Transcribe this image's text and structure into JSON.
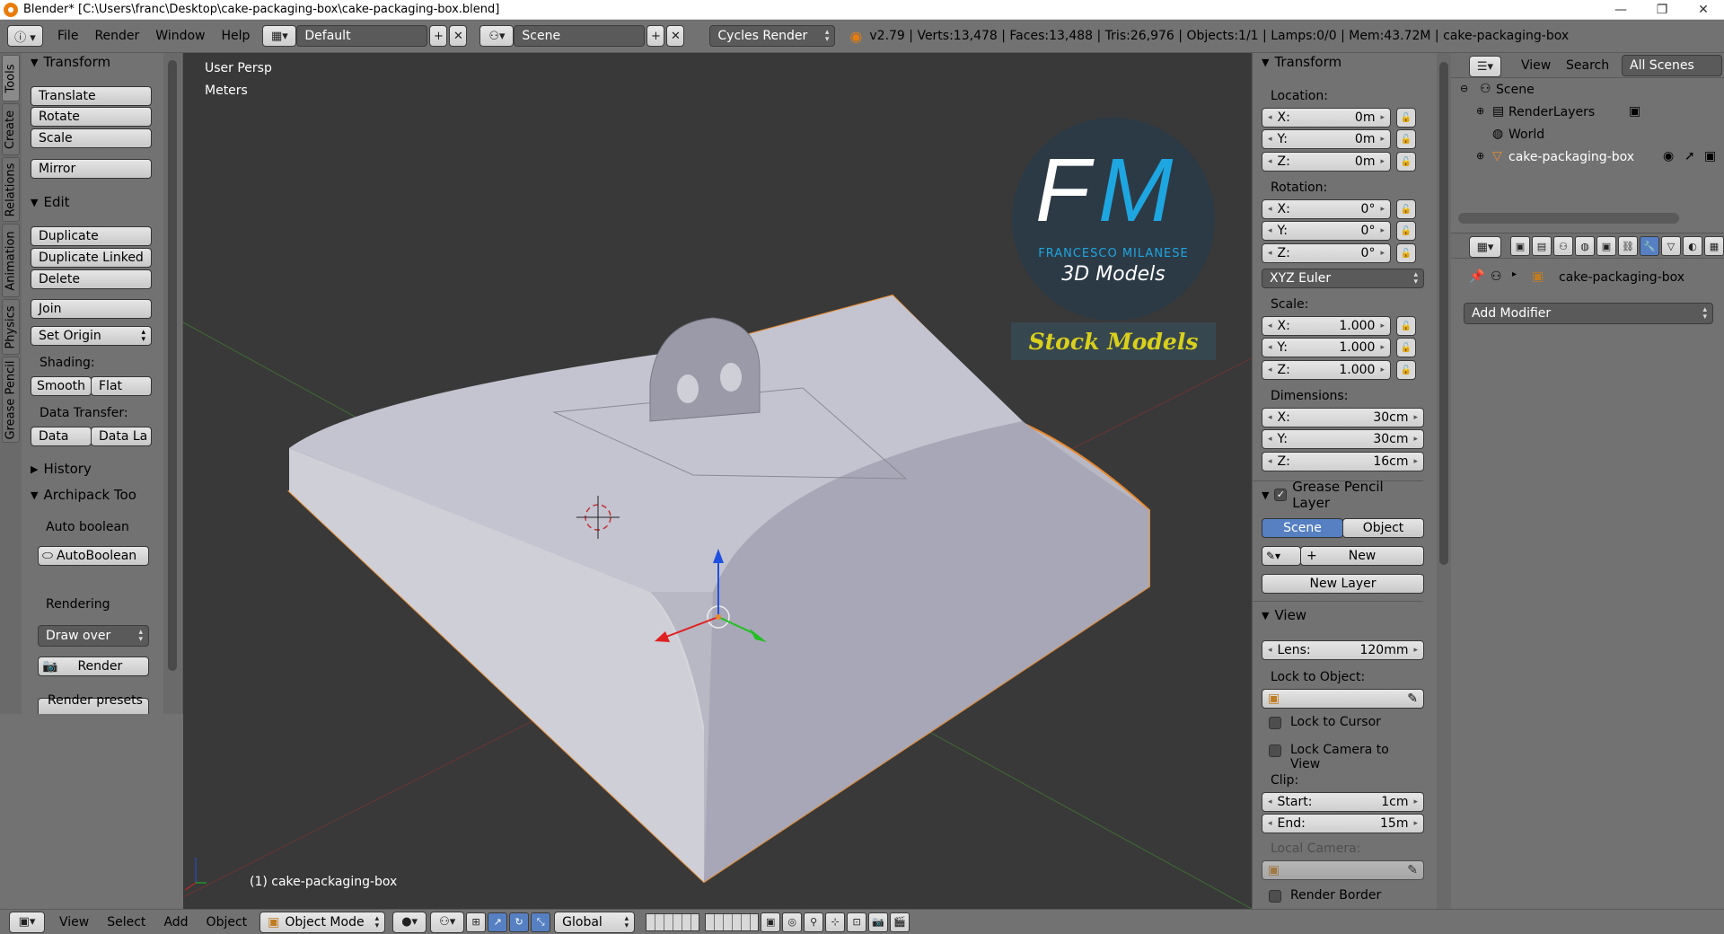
{
  "window": {
    "title": "Blender* [C:\\Users\\franc\\Desktop\\cake-packaging-box\\cake-packaging-box.blend]",
    "minimize": "—",
    "maximize": "❐",
    "close": "✕"
  },
  "topbar": {
    "menus": [
      "File",
      "Render",
      "Window",
      "Help"
    ],
    "layout": "Default",
    "scene": "Scene",
    "engine": "Cycles Render",
    "stats": "v2.79 | Verts:13,478 | Faces:13,488 | Tris:26,976 | Objects:1/1 | Lamps:0/0 | Mem:43.72M | cake-packaging-box"
  },
  "lefttabs": [
    "Tools",
    "Create",
    "Relations",
    "Animation",
    "Physics",
    "Grease Pencil"
  ],
  "tools": {
    "transform": {
      "header": "Transform",
      "translate": "Translate",
      "rotate": "Rotate",
      "scale": "Scale",
      "mirror": "Mirror"
    },
    "edit": {
      "header": "Edit",
      "duplicate": "Duplicate",
      "duplicate_linked": "Duplicate Linked",
      "delete": "Delete",
      "join": "Join",
      "set_origin": "Set Origin",
      "shading_label": "Shading:",
      "smooth": "Smooth",
      "flat": "Flat",
      "data_transfer_label": "Data Transfer:",
      "data": "Data",
      "data_la": "Data La"
    },
    "history": {
      "header": "History"
    },
    "archipack": {
      "header": "Archipack Too",
      "auto_boolean_label": "Auto boolean",
      "autoboolean_btn": "AutoBoolean",
      "rendering_label": "Rendering",
      "draw_over": "Draw over",
      "render_btn": "Render",
      "render_presets": "Render presets ..."
    }
  },
  "viewport": {
    "view_name": "User Persp",
    "units": "Meters",
    "object_label": "(1) cake-packaging-box",
    "watermark": {
      "initials_f": "F",
      "initials_m": "M",
      "name": "FRANCESCO MILANESE",
      "subtitle": "3D Models",
      "banner": "Stock Models"
    }
  },
  "nprops": {
    "transform_header": "Transform",
    "location_label": "Location:",
    "location": [
      {
        "axis": "X:",
        "value": "0m"
      },
      {
        "axis": "Y:",
        "value": "0m"
      },
      {
        "axis": "Z:",
        "value": "0m"
      }
    ],
    "rotation_label": "Rotation:",
    "rotation": [
      {
        "axis": "X:",
        "value": "0°"
      },
      {
        "axis": "Y:",
        "value": "0°"
      },
      {
        "axis": "Z:",
        "value": "0°"
      }
    ],
    "rotation_mode": "XYZ Euler",
    "scale_label": "Scale:",
    "scale": [
      {
        "axis": "X:",
        "value": "1.000"
      },
      {
        "axis": "Y:",
        "value": "1.000"
      },
      {
        "axis": "Z:",
        "value": "1.000"
      }
    ],
    "dimensions_label": "Dimensions:",
    "dimensions": [
      {
        "axis": "X:",
        "value": "30cm"
      },
      {
        "axis": "Y:",
        "value": "30cm"
      },
      {
        "axis": "Z:",
        "value": "16cm"
      }
    ],
    "grease_header": "Grease Pencil Layer",
    "gp_scene": "Scene",
    "gp_object": "Object",
    "gp_new": "New",
    "gp_new_layer": "New Layer",
    "view_header": "View",
    "lens_label": "Lens:",
    "lens_value": "120mm",
    "lock_to_object_label": "Lock to Object:",
    "lock_to_cursor": "Lock to Cursor",
    "lock_camera": "Lock Camera to View",
    "clip_label": "Clip:",
    "clip_start_label": "Start:",
    "clip_start": "1cm",
    "clip_end_label": "End:",
    "clip_end": "15m",
    "local_camera_label": "Local Camera:",
    "render_border": "Render Border"
  },
  "outliner": {
    "view": "View",
    "search": "Search",
    "all_scenes": "All Scenes",
    "items": [
      {
        "label": "Scene"
      },
      {
        "label": "RenderLayers"
      },
      {
        "label": "World"
      },
      {
        "label": "cake-packaging-box"
      }
    ]
  },
  "properties": {
    "object_name": "cake-packaging-box",
    "add_modifier": "Add Modifier"
  },
  "bottombar": {
    "menus": [
      "View",
      "Select",
      "Add",
      "Object"
    ],
    "mode": "Object Mode",
    "orientation": "Global"
  },
  "colors": {
    "accent": "#5680c2",
    "viewport_bg": "#393939",
    "panel_bg": "#727272",
    "selection_orange": "#e88a2e",
    "watermark_blue": "#1ea6e0",
    "watermark_yellow": "#d9d01c"
  }
}
